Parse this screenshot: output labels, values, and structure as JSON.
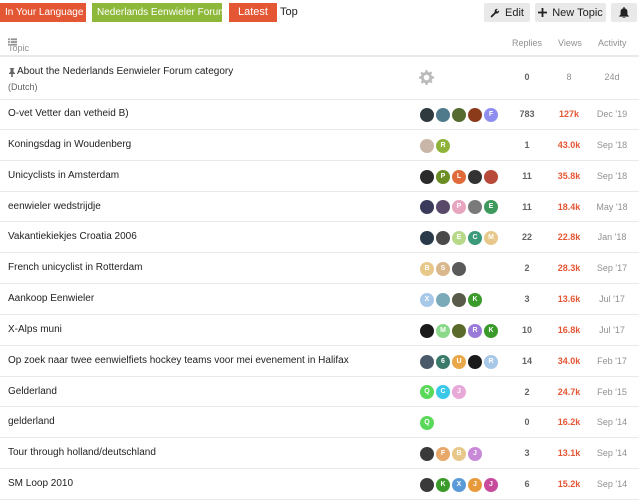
{
  "nav": {
    "crumb_category": "In Your Language",
    "crumb_subcategory": "Nederlands Eenwieler Forum",
    "tab_latest": "Latest",
    "tab_top": "Top",
    "edit_label": "Edit",
    "new_topic_label": "New Topic",
    "colors": {
      "category": "#e45735",
      "subcategory": "#8db83a",
      "active_tab": "#e45735"
    }
  },
  "header": {
    "topic": "Topic",
    "replies": "Replies",
    "views": "Views",
    "activity": "Activity"
  },
  "topics": [
    {
      "title": "About the Nederlands Eenwieler Forum category",
      "pinned": true,
      "subtitle": "(Dutch)",
      "replies": "0",
      "views": "8",
      "activity": "24d",
      "hot": false,
      "posters": []
    },
    {
      "title": "O-vet Vetter dan vetheid B)",
      "replies": "783",
      "views": "127k",
      "activity": "Dec '19",
      "hot": true,
      "posters": [
        {
          "c": "#2f3a3f",
          "t": ""
        },
        {
          "c": "#4f7a8c",
          "t": ""
        },
        {
          "c": "#556b2f",
          "t": ""
        },
        {
          "c": "#8b3a1a",
          "t": ""
        },
        {
          "c": "#8e8ef0",
          "t": "F"
        }
      ]
    },
    {
      "title": "Koningsdag in Woudenberg",
      "replies": "1",
      "views": "43.0k",
      "activity": "Sep '18",
      "hot": true,
      "posters": [
        {
          "c": "#c9b6a8",
          "t": ""
        },
        {
          "c": "#8fb33a",
          "t": "R"
        }
      ]
    },
    {
      "title": "Unicyclists in Amsterdam",
      "replies": "11",
      "views": "35.8k",
      "activity": "Sep '18",
      "hot": true,
      "posters": [
        {
          "c": "#2a2a2a",
          "t": ""
        },
        {
          "c": "#6a8e23",
          "t": "P"
        },
        {
          "c": "#e06a3a",
          "t": "L"
        },
        {
          "c": "#333333",
          "t": ""
        },
        {
          "c": "#b84a3a",
          "t": ""
        }
      ]
    },
    {
      "title": "eenwieler wedstrijdje",
      "replies": "11",
      "views": "18.4k",
      "activity": "May '18",
      "hot": true,
      "posters": [
        {
          "c": "#3a3a5a",
          "t": ""
        },
        {
          "c": "#5a4a6a",
          "t": ""
        },
        {
          "c": "#e8a5c0",
          "t": "P"
        },
        {
          "c": "#7a7a7a",
          "t": ""
        },
        {
          "c": "#3e9a5c",
          "t": "E"
        }
      ]
    },
    {
      "title": "Vakantiekiekjes Croatia 2006",
      "replies": "22",
      "views": "22.8k",
      "activity": "Jan '18",
      "hot": true,
      "posters": [
        {
          "c": "#2a3a4a",
          "t": ""
        },
        {
          "c": "#4a4a4a",
          "t": ""
        },
        {
          "c": "#b8d88a",
          "t": "E"
        },
        {
          "c": "#3a9a7a",
          "t": "C"
        },
        {
          "c": "#e8c88a",
          "t": "M"
        }
      ]
    },
    {
      "title": "French unicyclist in Rotterdam",
      "replies": "2",
      "views": "28.3k",
      "activity": "Sep '17",
      "hot": true,
      "posters": [
        {
          "c": "#e8c88a",
          "t": "B"
        },
        {
          "c": "#d8b88a",
          "t": "S"
        },
        {
          "c": "#5a5a5a",
          "t": ""
        }
      ]
    },
    {
      "title": "Aankoop Eenwieler",
      "replies": "3",
      "views": "13.6k",
      "activity": "Jul '17",
      "hot": true,
      "posters": [
        {
          "c": "#a8c8e8",
          "t": "X"
        },
        {
          "c": "#7aaab8",
          "t": ""
        },
        {
          "c": "#5a5a4a",
          "t": ""
        },
        {
          "c": "#3a9a2a",
          "t": "K"
        }
      ]
    },
    {
      "title": "X-Alps muni",
      "replies": "10",
      "views": "16.8k",
      "activity": "Jul '17",
      "hot": true,
      "posters": [
        {
          "c": "#1a1a1a",
          "t": ""
        },
        {
          "c": "#8ad88a",
          "t": "M"
        },
        {
          "c": "#5a6a2a",
          "t": ""
        },
        {
          "c": "#9a7ad8",
          "t": "R"
        },
        {
          "c": "#3a9a2a",
          "t": "K"
        }
      ]
    },
    {
      "title": "Op zoek naar twee eenwielfiets hockey teams voor mei evenement in Halifax",
      "replies": "14",
      "views": "34.0k",
      "activity": "Feb '17",
      "hot": true,
      "posters": [
        {
          "c": "#4a5a6a",
          "t": ""
        },
        {
          "c": "#3a7a6a",
          "t": "6"
        },
        {
          "c": "#e8a84a",
          "t": "U"
        },
        {
          "c": "#1a1a1a",
          "t": ""
        },
        {
          "c": "#a8c8e8",
          "t": "R"
        }
      ]
    },
    {
      "title": "Gelderland",
      "replies": "2",
      "views": "24.7k",
      "activity": "Feb '15",
      "hot": true,
      "posters": [
        {
          "c": "#5ad85a",
          "t": "Q"
        },
        {
          "c": "#3ac8e8",
          "t": "C"
        },
        {
          "c": "#e8a8d8",
          "t": "J"
        }
      ]
    },
    {
      "title": "gelderland",
      "replies": "0",
      "views": "16.2k",
      "activity": "Sep '14",
      "hot": true,
      "posters": [
        {
          "c": "#5ad85a",
          "t": "Q"
        }
      ]
    },
    {
      "title": "Tour through holland/deutschland",
      "replies": "3",
      "views": "13.1k",
      "activity": "Sep '14",
      "hot": true,
      "posters": [
        {
          "c": "#3a3a3a",
          "t": ""
        },
        {
          "c": "#e8a86a",
          "t": "F"
        },
        {
          "c": "#e8c88a",
          "t": "B"
        },
        {
          "c": "#c88ad8",
          "t": "J"
        }
      ]
    },
    {
      "title": "SM Loop 2010",
      "replies": "6",
      "views": "15.2k",
      "activity": "Sep '14",
      "hot": true,
      "posters": [
        {
          "c": "#3a3a3a",
          "t": ""
        },
        {
          "c": "#3a9a2a",
          "t": "K"
        },
        {
          "c": "#5a9ad8",
          "t": "X"
        },
        {
          "c": "#e89a3a",
          "t": "J"
        },
        {
          "c": "#c84a9a",
          "t": "J"
        }
      ]
    }
  ]
}
